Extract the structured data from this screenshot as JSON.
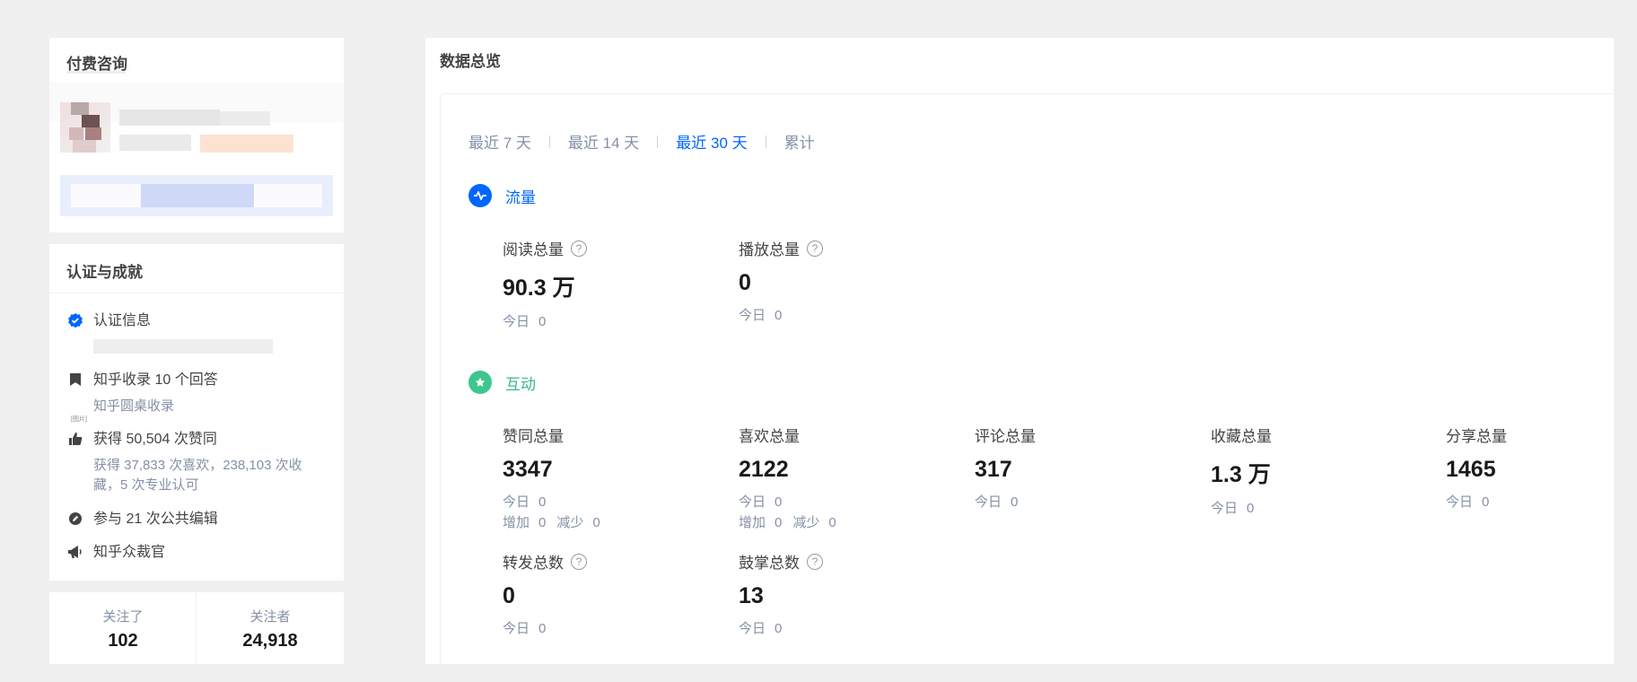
{
  "paid": {
    "title": "付费咨询"
  },
  "cert": {
    "title": "认证与成就",
    "items": [
      {
        "label": "认证信息",
        "icon": "verified-badge-icon"
      },
      {
        "label": "知乎收录 10 个回答",
        "sub": "知乎圆桌收录",
        "icon": "bookmark-icon"
      },
      {
        "label": "获得 50,504 次赞同",
        "sub": "获得 37,833 次喜欢，238,103 次收藏，5 次专业认可",
        "icon": "thumbs-up-icon"
      },
      {
        "label": "参与 21 次公共编辑",
        "icon": "edit-icon"
      },
      {
        "label": "知乎众裁官",
        "icon": "megaphone-icon"
      }
    ],
    "badge_text": "[图片]"
  },
  "follow": {
    "following_label": "关注了",
    "following_count": "102",
    "followers_label": "关注者",
    "followers_count": "24,918"
  },
  "main": {
    "title": "数据总览",
    "tabs": [
      "最近 7 天",
      "最近 14 天",
      "最近 30 天",
      "累计"
    ],
    "active_tab": "最近 30 天",
    "flow": {
      "title": "流量",
      "stats": [
        {
          "label": "阅读总量",
          "value": "90.3 万",
          "today_label": "今日",
          "today": "0"
        },
        {
          "label": "播放总量",
          "value": "0",
          "today_label": "今日",
          "today": "0"
        }
      ]
    },
    "interaction": {
      "title": "互动",
      "stats": [
        {
          "label": "赞同总量",
          "value": "3347",
          "today_label": "今日",
          "today": "0",
          "inc_label": "增加",
          "inc": "0",
          "dec_label": "减少",
          "dec": "0"
        },
        {
          "label": "喜欢总量",
          "value": "2122",
          "today_label": "今日",
          "today": "0",
          "inc_label": "增加",
          "inc": "0",
          "dec_label": "减少",
          "dec": "0"
        },
        {
          "label": "评论总量",
          "value": "317",
          "today_label": "今日",
          "today": "0"
        },
        {
          "label": "收藏总量",
          "value": "1.3 万",
          "today_label": "今日",
          "today": "0"
        },
        {
          "label": "分享总量",
          "value": "1465",
          "today_label": "今日",
          "today": "0"
        },
        {
          "label": "转发总数",
          "value": "0",
          "today_label": "今日",
          "today": "0"
        },
        {
          "label": "鼓掌总数",
          "value": "13",
          "today_label": "今日",
          "today": "0"
        }
      ]
    }
  },
  "colors": {
    "accent": "#0066ff",
    "interaction": "#3cc78e",
    "muted": "#8590a6"
  }
}
